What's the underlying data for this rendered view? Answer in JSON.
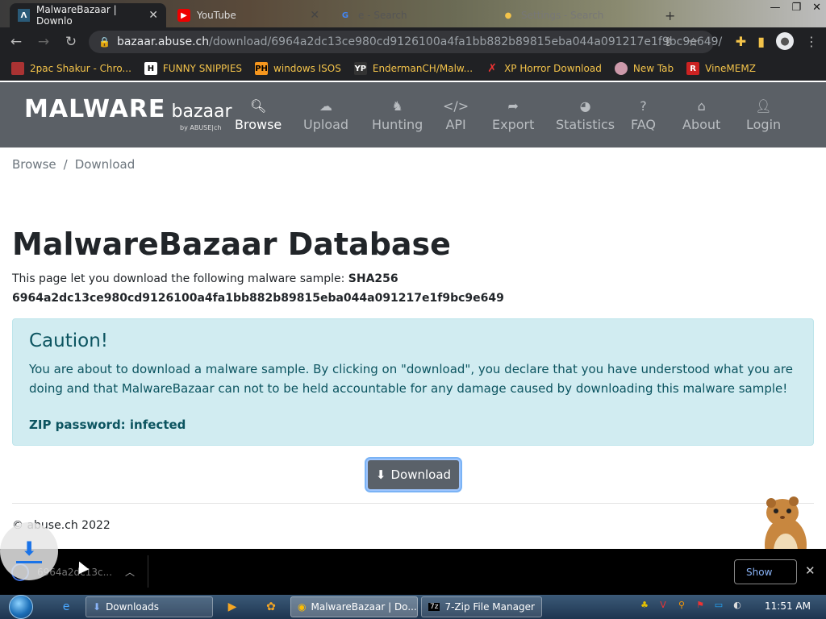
{
  "browser": {
    "tabs": [
      {
        "title": "MalwareBazaar | Downlo",
        "active": true
      },
      {
        "title": "YouTube",
        "active": false
      },
      {
        "title": "e - Search",
        "active": false
      },
      {
        "title": "Settings - Search",
        "active": false
      }
    ],
    "url": {
      "host": "bazaar.abuse.ch",
      "path": "/download/6964a2dc13ce980cd9126100a4fa1bb882b89815eba044a091217e1f9bc9e649/"
    },
    "bookmarks": [
      {
        "label": "2pac Shakur - Chro...",
        "icon": "2pac-favicon"
      },
      {
        "label": "FUNNY SNIPPIES",
        "icon": "H"
      },
      {
        "label": "windows ISOS",
        "icon": "PH"
      },
      {
        "label": "EndermanCH/Malw...",
        "icon": "YP"
      },
      {
        "label": "XP Horror Download",
        "icon": "X"
      },
      {
        "label": "New Tab",
        "icon": "globe"
      },
      {
        "label": "VineMEMZ",
        "icon": "R"
      }
    ]
  },
  "site": {
    "logo_main": "MALWARE",
    "logo_sub": "bazaar",
    "logo_by": "by ABUSE|ch",
    "nav": [
      {
        "label": "Browse",
        "icon": "search-icon",
        "active": true
      },
      {
        "label": "Upload",
        "icon": "cloud-upload-icon",
        "active": false
      },
      {
        "label": "Hunting",
        "icon": "hunting-icon",
        "active": false
      },
      {
        "label": "API",
        "icon": "code-icon",
        "active": false
      },
      {
        "label": "Export",
        "icon": "export-icon",
        "active": false
      },
      {
        "label": "Statistics",
        "icon": "pie-chart-icon",
        "active": false
      },
      {
        "label": "FAQ",
        "icon": "question-icon",
        "active": false
      },
      {
        "label": "About",
        "icon": "building-icon",
        "active": false
      },
      {
        "label": "Login",
        "icon": "user-icon",
        "active": false
      }
    ]
  },
  "page": {
    "breadcrumb": [
      "Browse",
      "Download"
    ],
    "title": "MalwareBazaar Database",
    "desc_prefix": "This page let you download the following malware sample: ",
    "hash_label": "SHA256",
    "hash": "6964a2dc13ce980cd9126100a4fa1bb882b89815eba044a091217e1f9bc9e649",
    "alert_title": "Caution!",
    "alert_text": "You are about to download a malware sample. By clicking on \"download\", you declare that you have understood what you are doing and that MalwareBazaar can not to be held accountable for any damage caused by downloading this malware sample!",
    "zip_password": "ZIP password: infected",
    "download_label": "Download",
    "footer": "© abuse.ch 2022"
  },
  "downloads_bar": {
    "file": "6964a2dc13c...",
    "show_all": "Show"
  },
  "taskbar": {
    "tasks": [
      {
        "label": "Downloads",
        "active": false
      },
      {
        "label": "MalwareBazaar | Do...",
        "active": true
      },
      {
        "label": "7-Zip File Manager",
        "active": false
      }
    ],
    "clock": "11:51 AM"
  },
  "colors": {
    "nav_bg": "#5b6066",
    "alert_bg": "#d1ecf1",
    "alert_text": "#0c5460",
    "button_bg": "#5a6169"
  }
}
